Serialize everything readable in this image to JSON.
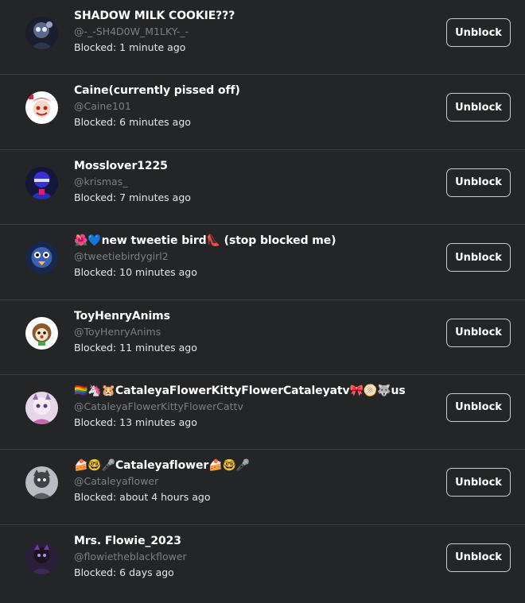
{
  "unblock_label": "Unblock",
  "users": [
    {
      "display_name": "SHADOW MILK COOKIE???",
      "handle": "@-_-SH4D0W_M1LKY-_-",
      "blocked": "Blocked: 1 minute ago",
      "avatar": "avatar-shadow-milk-cookie"
    },
    {
      "display_name": "Caine(currently pissed off)",
      "handle": "@Caine101",
      "blocked": "Blocked: 6 minutes ago",
      "avatar": "avatar-caine"
    },
    {
      "display_name": "Mosslover1225",
      "handle": "@krismas_",
      "blocked": "Blocked: 7 minutes ago",
      "avatar": "avatar-mosslover"
    },
    {
      "display_name": "🌺💙new tweetie bird👠 (stop blocked me)",
      "handle": "@tweetiebirdygirl2",
      "blocked": "Blocked: 10 minutes ago",
      "avatar": "avatar-tweetie-bird"
    },
    {
      "display_name": "ToyHenryAnims",
      "handle": "@ToyHenryAnims",
      "blocked": "Blocked: 11 minutes ago",
      "avatar": "avatar-toyhenry"
    },
    {
      "display_name": "🏳️‍🌈🦄🐹CataleyaFlowerKittyFlowerCataleyatv🎀🫓🐺us",
      "handle": "@CataleyaFlowerKittyFlowerCattv",
      "blocked": "Blocked: 13 minutes ago",
      "avatar": "avatar-cataleya-kitty"
    },
    {
      "display_name": "🍰🤓🎤Cataleyaflower🍰🤓🎤",
      "handle": "@Cataleyaflower",
      "blocked": "Blocked: about 4 hours ago",
      "avatar": "avatar-cataleyaflower"
    },
    {
      "display_name": "Mrs. Flowie_2023",
      "handle": "@flowietheblackflower",
      "blocked": "Blocked: 6 days ago",
      "avatar": "avatar-flowie"
    }
  ]
}
